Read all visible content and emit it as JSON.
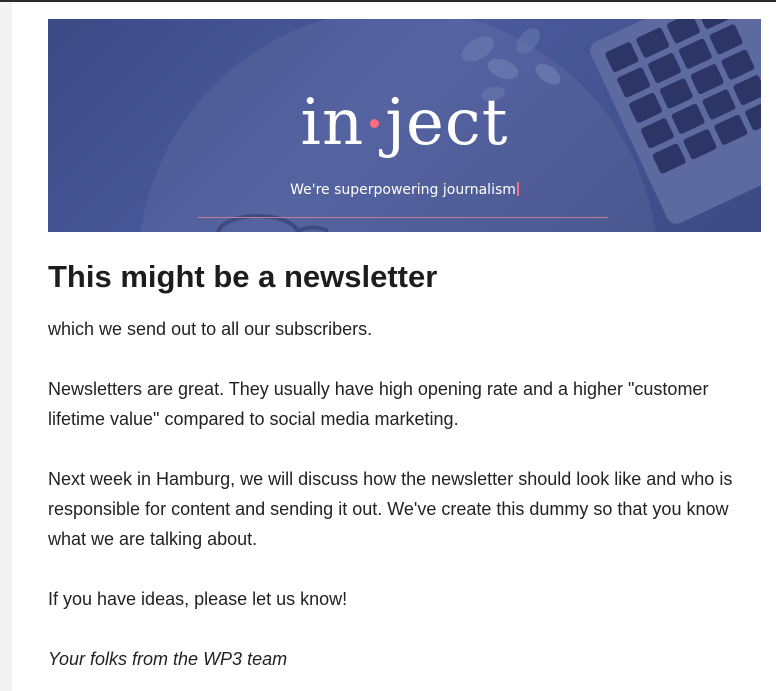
{
  "banner": {
    "brand_left": "in",
    "brand_right": "ject",
    "tagline": "We're superpowering journalism"
  },
  "article": {
    "headline": "This might be a newsletter",
    "paragraphs": [
      "which we send out to all our subscribers.",
      "Newsletters are great. They usually have high opening rate and a higher \"customer lifetime value\" compared to social media marketing.",
      "Next week in Hamburg, we will discuss how the newsletter should look like and who is responsible for content and sending it out. We've create this dummy so that you know what we are talking about.",
      "If you have ideas, please let us know!"
    ],
    "signoff": "Your folks from the WP3 team"
  },
  "colors": {
    "banner_bg": "#414f8e",
    "accent": "#ff6b7f",
    "text": "#222222"
  }
}
